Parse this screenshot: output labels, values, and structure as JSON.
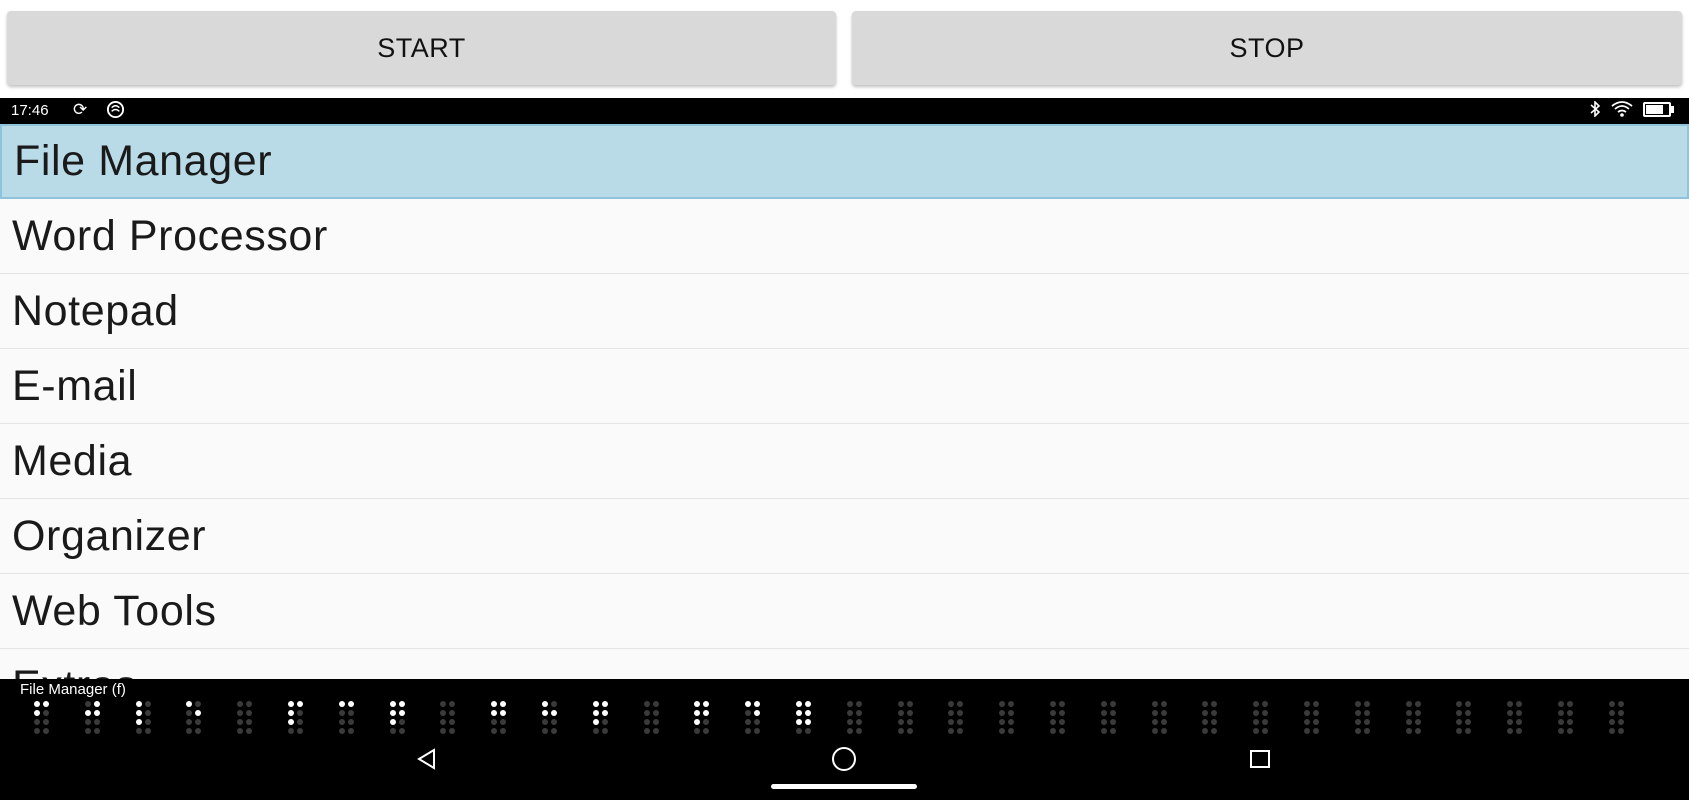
{
  "top_buttons": {
    "start_label": "START",
    "stop_label": "STOP"
  },
  "status_bar": {
    "time": "17:46",
    "left_icons": [
      "sync-icon",
      "circle-icon"
    ],
    "right_icons": [
      "bluetooth-icon",
      "wifi-icon",
      "battery-icon"
    ]
  },
  "menu": {
    "items": [
      {
        "label": "File Manager",
        "selected": true
      },
      {
        "label": "Word Processor",
        "selected": false
      },
      {
        "label": "Notepad",
        "selected": false
      },
      {
        "label": "E-mail",
        "selected": false
      },
      {
        "label": "Media",
        "selected": false
      },
      {
        "label": "Organizer",
        "selected": false
      },
      {
        "label": "Web Tools",
        "selected": false
      },
      {
        "label": "Extras",
        "selected": false
      }
    ]
  },
  "braille_display": {
    "caption": "File Manager (f)",
    "cells": [
      [
        1,
        2,
        4
      ],
      [
        2,
        4,
        5
      ],
      [
        1,
        2,
        3
      ],
      [
        1,
        5
      ],
      [],
      [
        1,
        2,
        3,
        4
      ],
      [
        1,
        4
      ],
      [
        1,
        2,
        3,
        4,
        5
      ],
      [],
      [
        1,
        2,
        4,
        5
      ],
      [
        1,
        2,
        5
      ],
      [
        1,
        2,
        3,
        4,
        5
      ],
      [],
      [
        1,
        2,
        3,
        4,
        5
      ],
      [
        1,
        4,
        5
      ],
      [
        1,
        2,
        3,
        4,
        5,
        6
      ],
      [],
      [],
      [],
      [],
      [],
      [],
      [],
      [],
      [],
      [],
      [],
      [],
      [],
      [],
      [],
      []
    ]
  },
  "nav_bar": {
    "icons": [
      "back-icon",
      "home-icon",
      "recents-icon"
    ]
  }
}
